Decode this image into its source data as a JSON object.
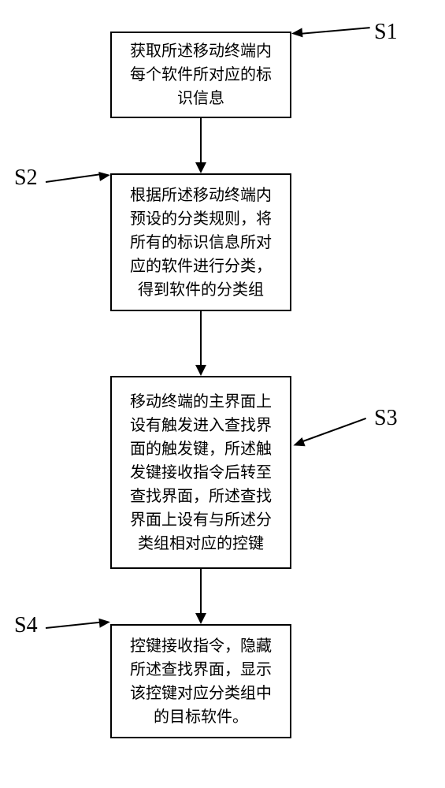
{
  "flowchart": {
    "steps": [
      {
        "id": "S1",
        "label": "S1",
        "text": "获取所述移动终端内每个软件所对应的标识信息"
      },
      {
        "id": "S2",
        "label": "S2",
        "text": "根据所述移动终端内预设的分类规则，将所有的标识信息所对应的软件进行分类，得到软件的分类组"
      },
      {
        "id": "S3",
        "label": "S3",
        "text": "移动终端的主界面上设有触发进入查找界面的触发键，所述触发键接收指令后转至查找界面，所述查找界面上设有与所述分类组相对应的控键"
      },
      {
        "id": "S4",
        "label": "S4",
        "text": "控键接收指令，隐藏所述查找界面，显示该控键对应分类组中的目标软件。"
      }
    ]
  }
}
